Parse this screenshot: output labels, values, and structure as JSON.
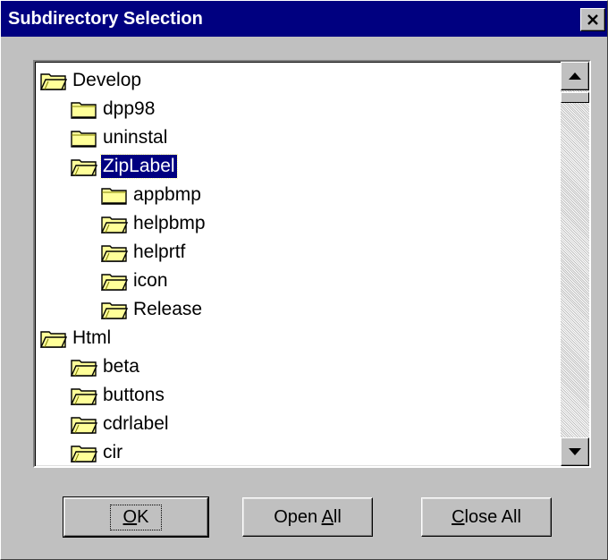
{
  "window": {
    "title": "Subdirectory Selection"
  },
  "tree": {
    "items": [
      {
        "label": "Develop",
        "level": 0,
        "icon": "folder-open-icon"
      },
      {
        "label": "dpp98",
        "level": 1,
        "icon": "folder-closed-icon"
      },
      {
        "label": "uninstal",
        "level": 1,
        "icon": "folder-closed-icon"
      },
      {
        "label": "ZipLabel",
        "level": 1,
        "icon": "folder-open-icon",
        "selected": true
      },
      {
        "label": "appbmp",
        "level": 2,
        "icon": "folder-closed-icon"
      },
      {
        "label": "helpbmp",
        "level": 2,
        "icon": "folder-open-icon"
      },
      {
        "label": "helprtf",
        "level": 2,
        "icon": "folder-open-icon"
      },
      {
        "label": "icon",
        "level": 2,
        "icon": "folder-open-icon"
      },
      {
        "label": "Release",
        "level": 2,
        "icon": "folder-open-icon"
      },
      {
        "label": "Html",
        "level": 0,
        "icon": "folder-open-icon"
      },
      {
        "label": "beta",
        "level": 1,
        "icon": "folder-open-icon"
      },
      {
        "label": "buttons",
        "level": 1,
        "icon": "folder-open-icon"
      },
      {
        "label": "cdrlabel",
        "level": 1,
        "icon": "folder-open-icon"
      },
      {
        "label": "cir",
        "level": 1,
        "icon": "folder-open-icon"
      }
    ]
  },
  "buttons": {
    "ok": {
      "mnemonic": "O",
      "rest": "K"
    },
    "open_all": {
      "prefix": "Open ",
      "mnemonic": "A",
      "rest": "ll"
    },
    "close_all": {
      "mnemonic": "C",
      "rest": "lose All"
    }
  },
  "colors": {
    "titlebar": "#000080",
    "face": "#c0c0c0",
    "selection": "#000080",
    "folder": "#ffff99"
  }
}
